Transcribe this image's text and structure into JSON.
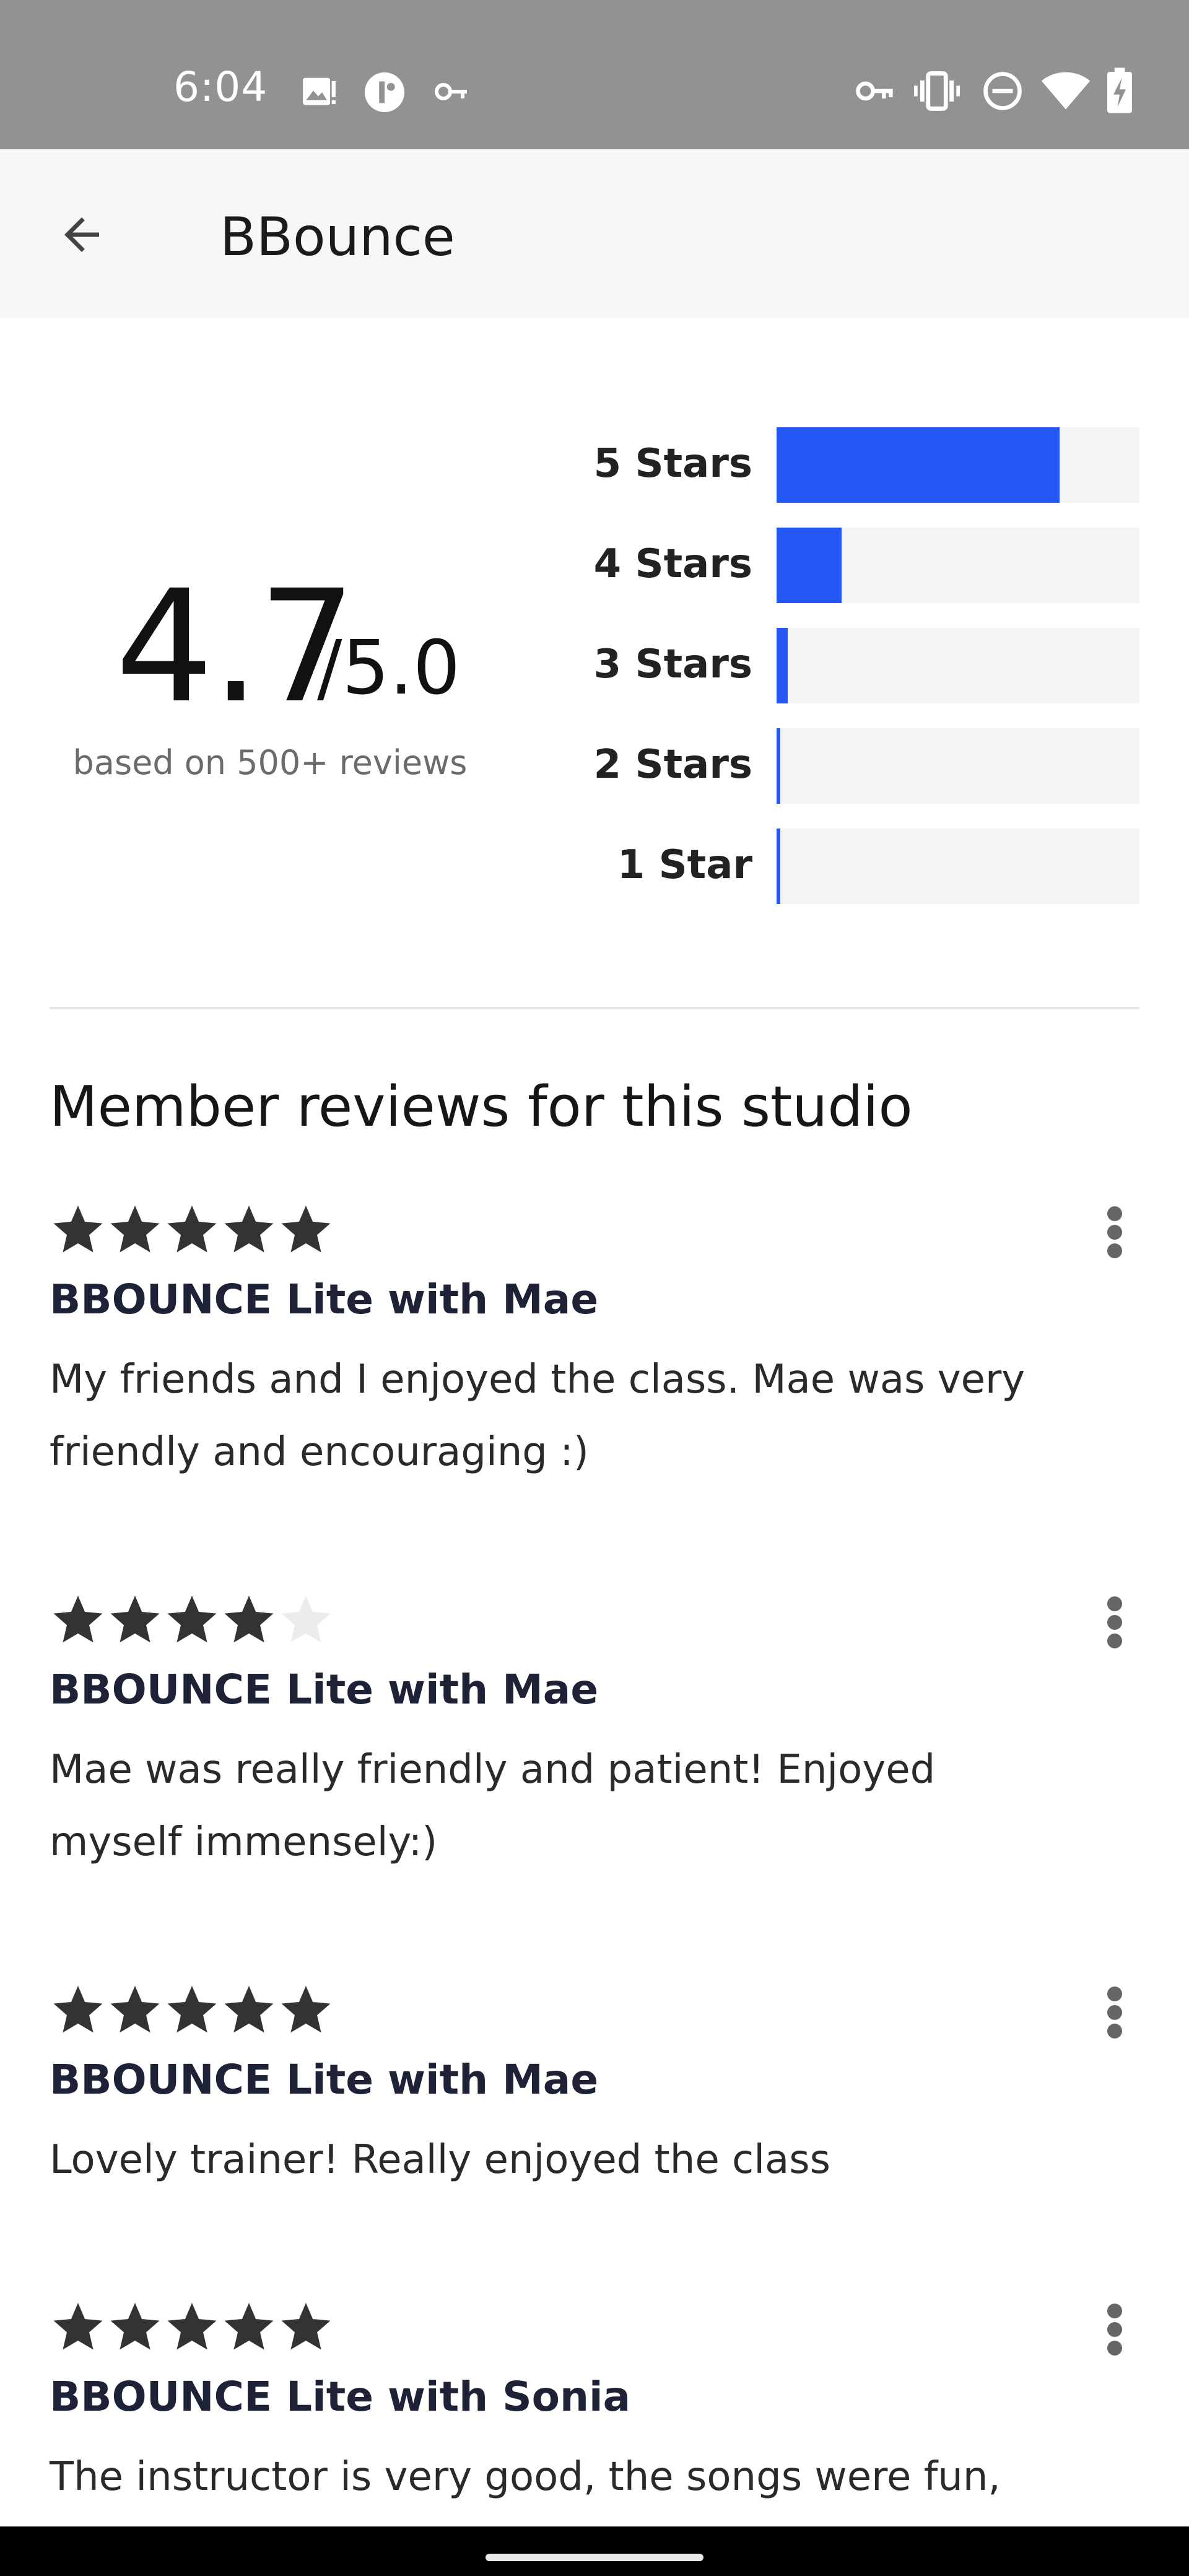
{
  "status_bar": {
    "time": "6:04",
    "icons_left": [
      "image-alert-icon",
      "app-notification-icon",
      "key-icon"
    ],
    "icons_right": [
      "vpn-key-icon",
      "vibrate-icon",
      "do-not-disturb-icon",
      "wifi-icon",
      "battery-charging-icon"
    ]
  },
  "app_bar": {
    "back_icon": "arrow-left-icon",
    "title": "BBounce"
  },
  "rating": {
    "score": "4.7",
    "max": "/5.0",
    "subtitle": "based on 500+ reviews",
    "accent": "#2457f5",
    "distribution": [
      {
        "label": "5 Stars",
        "fraction": 0.78
      },
      {
        "label": "4 Stars",
        "fraction": 0.18
      },
      {
        "label": "3 Stars",
        "fraction": 0.03
      },
      {
        "label": "2 Stars",
        "fraction": 0.01
      },
      {
        "label": "1 Star",
        "fraction": 0.01
      }
    ]
  },
  "section_title": "Member reviews for this studio",
  "reviews": [
    {
      "stars": 5,
      "class_name": "BBOUNCE Lite with Mae",
      "text": "My friends and I enjoyed the class. Mae was very friendly and encouraging :)"
    },
    {
      "stars": 4,
      "class_name": "BBOUNCE Lite with Mae",
      "text": "Mae was really friendly and patient! Enjoyed myself immensely:)"
    },
    {
      "stars": 5,
      "class_name": "BBOUNCE Lite with Mae",
      "text": "Lovely trainer! Really enjoyed the class"
    },
    {
      "stars": 5,
      "class_name": "BBOUNCE Lite with Sonia",
      "text": "The instructor is very good, the songs were fun, and"
    }
  ]
}
